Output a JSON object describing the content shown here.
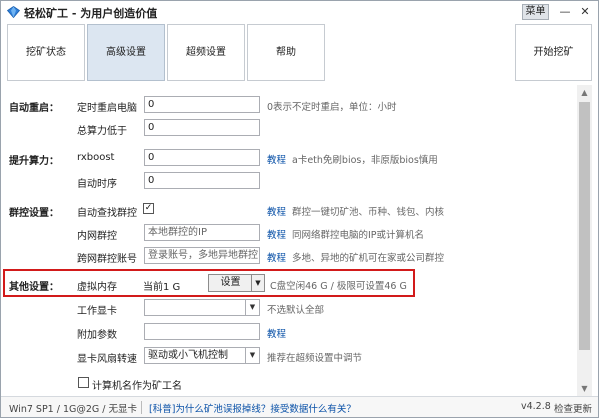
{
  "window": {
    "title": "轻松矿工 - 为用户创造价值",
    "menu_label": "菜单",
    "minimize": "—",
    "close": "✕"
  },
  "tabs": [
    {
      "label": "挖矿状态",
      "active": false
    },
    {
      "label": "高级设置",
      "active": true
    },
    {
      "label": "超频设置",
      "active": false
    },
    {
      "label": "帮助",
      "active": false
    }
  ],
  "start_button": "开始挖矿",
  "sections": {
    "auto_restart": {
      "label": "自动重启：",
      "timed_restart_label": "定时重启电脑",
      "timed_restart_value": "0",
      "timed_restart_hint": "0表示不定时重启，单位：小时",
      "total_hashrate_label": "总算力低于",
      "total_hashrate_value": "0"
    },
    "boost": {
      "label": "提升算力：",
      "rxboost_label": "rxboost",
      "rxboost_value": "0",
      "rxboost_link": "教程",
      "rxboost_hint": "a卡eth免刷bios，非原版bios慎用",
      "auto_timing_label": "自动时序",
      "auto_timing_value": "0"
    },
    "cluster": {
      "label": "群控设置：",
      "auto_find_label": "自动查找群控",
      "auto_find_checked": true,
      "auto_find_link": "教程",
      "auto_find_hint": "群控一键切矿池、币种、钱包、内核",
      "lan_label": "内网群控",
      "lan_placeholder": "本地群控的IP",
      "lan_link": "教程",
      "lan_hint": "同网络群控电脑的IP或计算机名",
      "wan_label": "跨网群控账号",
      "wan_placeholder": "登录账号，多地异地群控",
      "wan_link": "教程",
      "wan_hint": "多地、异地的矿机可在家或公司群控"
    },
    "other": {
      "label": "其他设置：",
      "vmem_label": "虚拟内存",
      "vmem_current": "当前1 G",
      "set_button": "设置",
      "vmem_info": "C盘空闲46 G / 极限可设置46 G",
      "gpu_label": "工作显卡",
      "gpu_value": "",
      "gpu_hint": "不选默认全部",
      "extra_params_label": "附加参数",
      "extra_params_value": "",
      "extra_params_link": "教程",
      "fan_label": "显卡风扇转速",
      "fan_value": "驱动或小飞机控制",
      "fan_hint": "推荐在超频设置中调节",
      "use_hostname_label": "计算机名作为矿工名",
      "use_hostname_checked": false
    }
  },
  "status": {
    "system_info": "Win7 SP1 / 1G@2G / 无显卡",
    "news": "[科普]为什么矿池误报掉线？接受数据什么有关？",
    "version": "v4.2.8",
    "update_check": "检查更新"
  },
  "colors": {
    "accent": "#0b52a8",
    "highlight_border": "#d21a1a",
    "active_tab": "#dce6f1"
  }
}
